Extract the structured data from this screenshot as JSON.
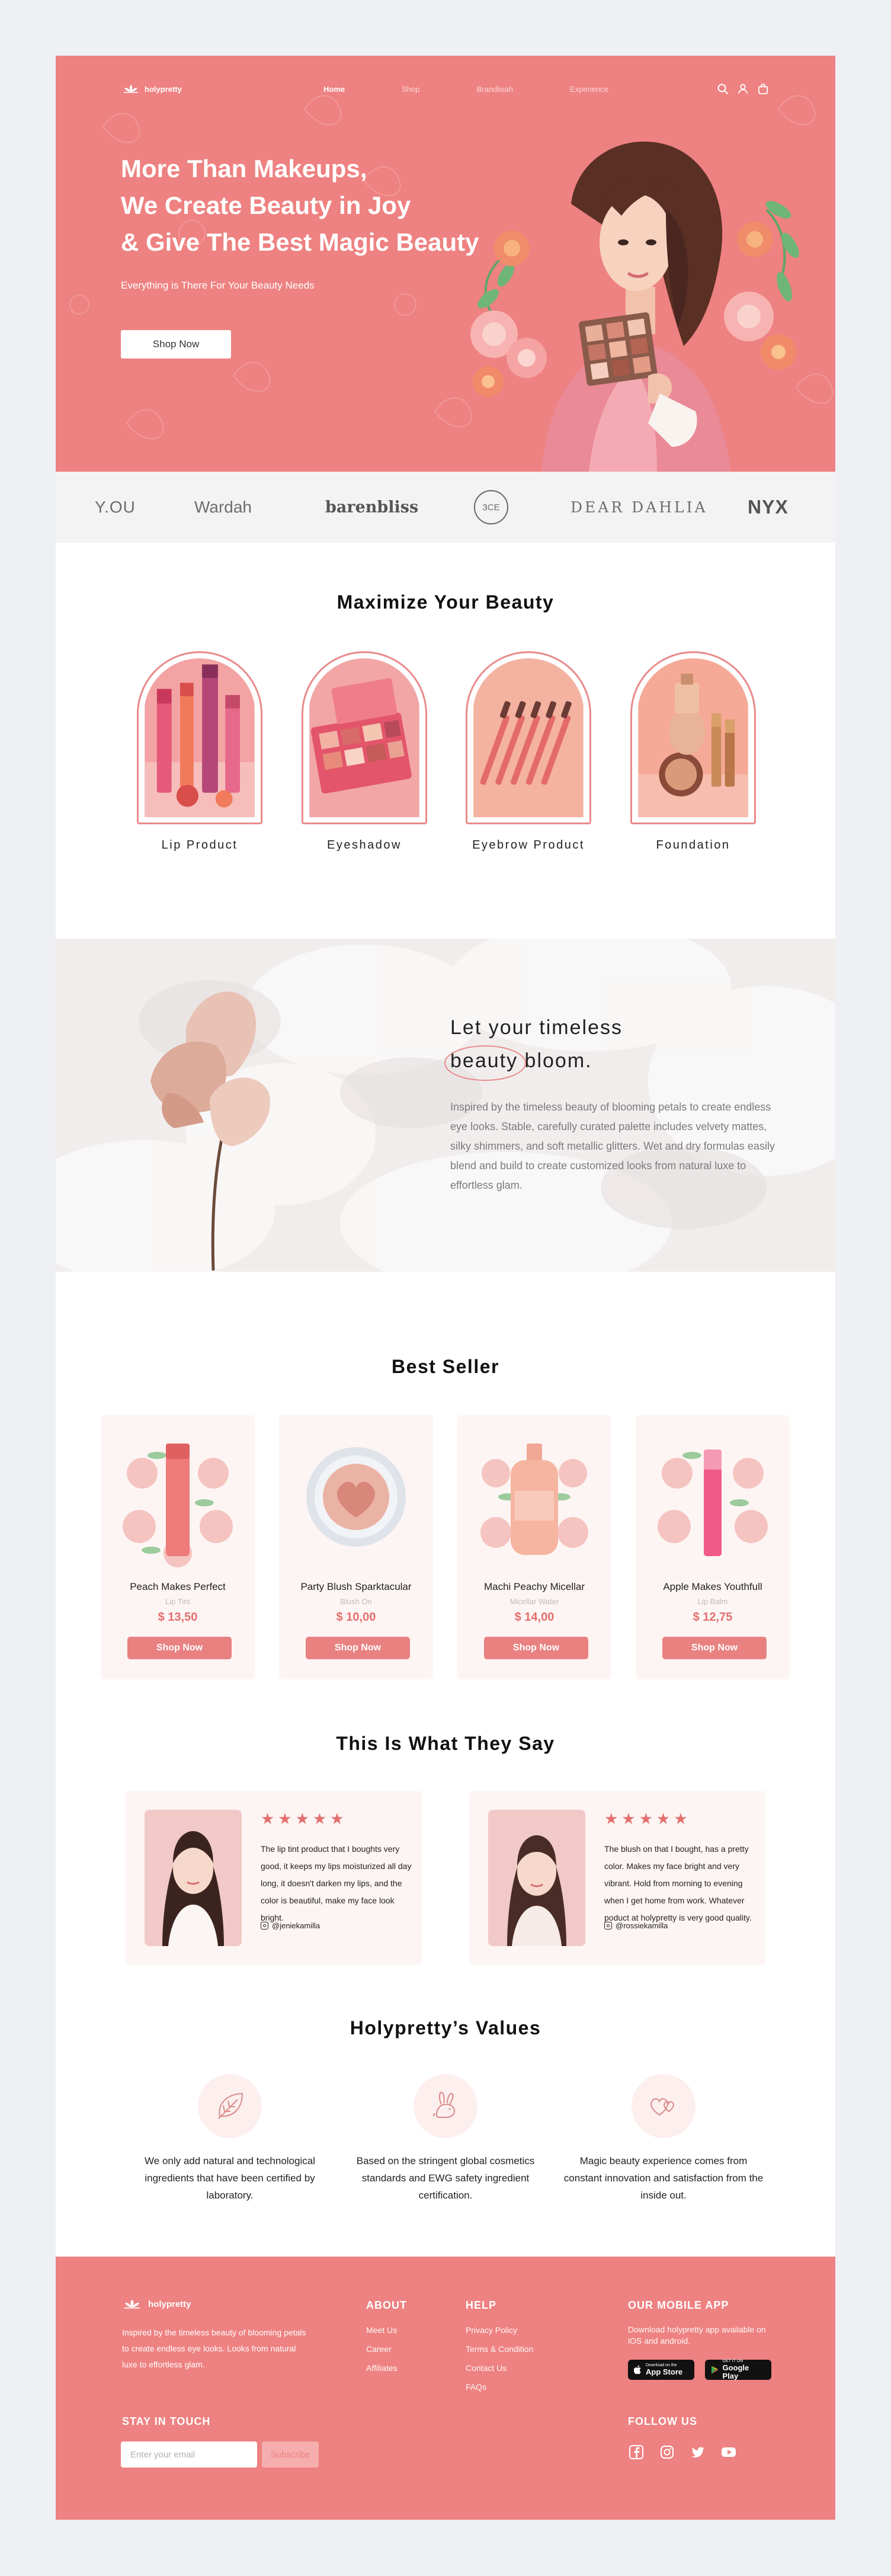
{
  "nav": {
    "logo": "holypretty",
    "links": [
      "Home",
      "Shop",
      "Brandlisah",
      "Experience"
    ]
  },
  "hero": {
    "title_lines": [
      "More Than Makeups,",
      "We Create Beauty in Joy",
      "& Give The Best Magic Beauty"
    ],
    "subtitle": "Everything is There For Your Beauty Needs",
    "cta": "Shop Now"
  },
  "brands": [
    "Y.OU",
    "Wardah",
    "barenbliss",
    "3CE",
    "DEAR DAHLIA",
    "NYX"
  ],
  "categories": {
    "title": "Maximize Your Beauty",
    "items": [
      "Lip Product",
      "Eyeshadow",
      "Eyebrow Product",
      "Foundation"
    ]
  },
  "bloom": {
    "title_line1": "Let your timeless",
    "title_circled": "beauty",
    "title_rest": " bloom.",
    "text": "Inspired by the timeless beauty of blooming petals to create endless eye looks. Stable, carefully curated palette includes velvety mattes, silky shimmers, and soft metallic glitters. Wet and dry formulas easily blend and build to create customized looks from natural luxe to effortless glam."
  },
  "best_seller": {
    "title": "Best Seller",
    "products": [
      {
        "name": "Peach Makes Perfect",
        "type": "Lip Tint",
        "price": "$ 13,50",
        "cta": "Shop Now"
      },
      {
        "name": "Party Blush Sparktacular",
        "type": "Blush On",
        "price": "$ 10,00",
        "cta": "Shop Now"
      },
      {
        "name": "Machi Peachy Micellar",
        "type": "Micellar Water",
        "price": "$ 14,00",
        "cta": "Shop Now"
      },
      {
        "name": "Apple Makes Youthfull",
        "type": "Lip Balm",
        "price": "$ 12,75",
        "cta": "Shop Now"
      }
    ]
  },
  "testimonials": {
    "title": "This Is What They Say",
    "items": [
      {
        "stars": "★★★★★",
        "rating": 5,
        "quote": "The lip tint product that I boughts very good, it keeps my lips moisturized all day long, it doesn't darken my lips, and the color is beautiful, make my face look bright.",
        "handle": "@jeniekamilla"
      },
      {
        "stars": "★★★★★",
        "rating": 5,
        "quote": "The blush on that I bought, has a pretty color. Makes my face bright and very vibrant. Hold from morning to evening when I get home from work. Whatever poduct at holypretty is very good quality.",
        "handle": "@rossiekamilla"
      }
    ]
  },
  "values": {
    "title": "Holypretty’s Values",
    "items": [
      {
        "icon": "leaf-icon",
        "text": "We only add natural and technological ingredients that have been certified by laboratory."
      },
      {
        "icon": "rabbit-icon",
        "text": "Based on the stringent global cosmetics standards and EWG safety ingredient certification."
      },
      {
        "icon": "hearts-icon",
        "text": "Magic beauty experience comes from constant innovation and satisfaction from the inside out."
      }
    ]
  },
  "footer": {
    "logo": "holypretty",
    "description": "Inspired by the timeless beauty of blooming petals to create endless eye looks. Looks from natural luxe to effortless glam.",
    "about_title": "ABOUT",
    "about_links": [
      "Meet Us",
      "Career",
      "Affiliates"
    ],
    "help_title": "HELP",
    "help_links": [
      "Privacy Policy",
      "Terms & Condition",
      "Contact Us",
      "FAQs"
    ],
    "app_title": "OUR MOBILE APP",
    "app_desc": "Download holypretty app available on iOS and android.",
    "app_store_small": "Download on the",
    "app_store": "App Store",
    "play_small": "GET IT ON",
    "play": "Google Play",
    "stay_title": "STAY IN TOUCH",
    "email_placeholder": "Enter your email",
    "subscribe": "Subscribe",
    "follow_title": "FOLLOW US"
  },
  "colors": {
    "brand_coral": "#ee8181",
    "price_red": "#e46f6f",
    "card_bg": "#fdf5f4",
    "page_bg": "#eef0f3"
  }
}
